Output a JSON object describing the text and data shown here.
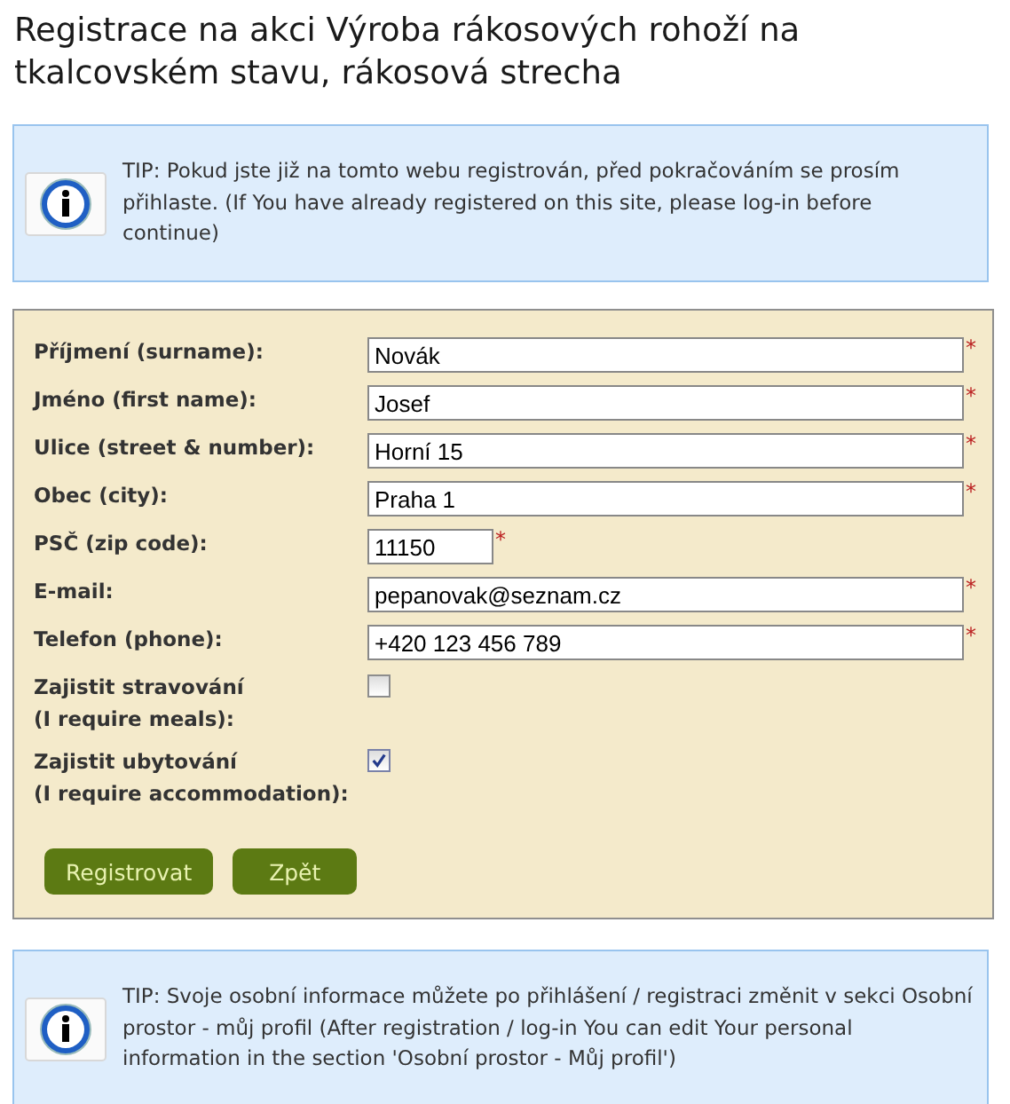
{
  "title": "Registrace na akci Výroba rákosových rohoží na tkalcovském stavu, rákosová strecha",
  "tip_top": "TIP: Pokud jste již na tomto webu registrován, před pokračováním se prosím přihlaste. (If You have already registered on this site, please log-in before continue)",
  "fields": [
    {
      "kind": "text",
      "label": "Příjmení (surname):",
      "value": "Novák",
      "required_mark": "*"
    },
    {
      "kind": "text",
      "label": "Jméno (first name):",
      "value": "Josef",
      "required_mark": "*"
    },
    {
      "kind": "text",
      "label": "Ulice (street & number):",
      "value": "Horní 15",
      "required_mark": "*"
    },
    {
      "kind": "text",
      "label": "Obec (city):",
      "value": "Praha 1",
      "required_mark": "*"
    },
    {
      "kind": "short",
      "label": "PSČ (zip code):",
      "value": "11150",
      "required_mark": "*"
    },
    {
      "kind": "text",
      "label": "E-mail:",
      "value": "pepanovak@seznam.cz",
      "required_mark": "*"
    },
    {
      "kind": "text",
      "label": "Telefon (phone):",
      "value": "+420 123 456 789",
      "required_mark": "*"
    },
    {
      "kind": "checkbox",
      "label": "Zajistit stravování\n(I require meals):",
      "checked": false
    },
    {
      "kind": "checkbox",
      "label": "Zajistit ubytování\n(I require accommodation):",
      "checked": true
    }
  ],
  "buttons": [
    "Registrovat",
    "Zpět"
  ],
  "tip_bottom": "TIP: Svoje osobní informace můžete po přihlášení / registraci změnit v sekci Osobní prostor - můj profil (After registration / log-in You can edit Your personal information in the section 'Osobní prostor - Můj profil')"
}
